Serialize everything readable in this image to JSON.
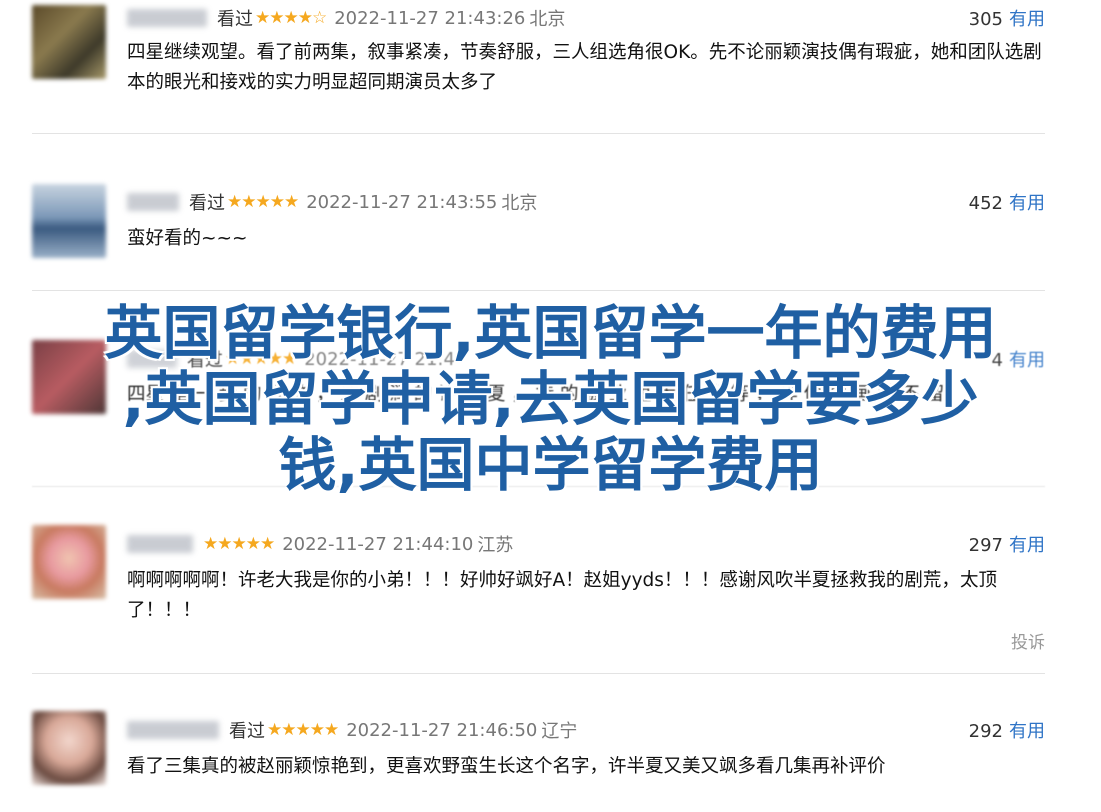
{
  "comments": [
    {
      "name": "",
      "status": "看过",
      "stars": "★★★★☆",
      "time": "2022-11-27 21:43:26",
      "location": "北京",
      "votes": "305",
      "vote_label": "有用",
      "text": "四星继续观望。看了前两集，叙事紧凑，节奏舒服，三人组选角很OK。先不论丽颖演技偶有瑕疵，她和团队选剧本的眼光和接戏的实力明显超同期演员太多了"
    },
    {
      "name": "",
      "status": "看过",
      "stars": "★★★★★",
      "time": "2022-11-27 21:43:55",
      "location": "北京",
      "votes": "452",
      "vote_label": "有用",
      "text": "蛮好看的~~~"
    },
    {
      "name": "",
      "status": "看过",
      "stars": "★★★★★",
      "time": "2022-11-27 21:4",
      "location": "",
      "votes": "4",
      "vote_label": "有用",
      "text": "四星 是 一 步 的 人 物 ， 这 剧 润 的 许 半 夏 ， 持 的 被 业 里 大 任 雀 等 ， 样 像 刻 画 成 不 留"
    },
    {
      "name": "",
      "status": "",
      "stars": "★★★★★",
      "time": "2022-11-27 21:44:10",
      "location": "江苏",
      "votes": "297",
      "vote_label": "有用",
      "text": "啊啊啊啊啊！许老大我是你的小弟！！！好帅好飒好A！赵姐yyds！！！感谢风吹半夏拯救我的剧荒，太顶了！！！",
      "report": "投诉"
    },
    {
      "name": "",
      "status": "看过",
      "stars": "★★★★★",
      "time": "2022-11-27 21:46:50",
      "location": "辽宁",
      "votes": "292",
      "vote_label": "有用",
      "text": "看了三集真的被赵丽颖惊艳到，更喜欢野蛮生长这个名字，许半夏又美又飒多看几集再补评价"
    }
  ],
  "overlay": {
    "line1": "英国留学银行,英国留学一年的费用",
    "line2": ",英国留学申请,去英国留学要多少",
    "line3": "钱,英国中学留学费用"
  },
  "colors": {
    "accent": "#2f74c6",
    "star": "#f5a81f",
    "overlay_text": "#1f5fa3"
  }
}
